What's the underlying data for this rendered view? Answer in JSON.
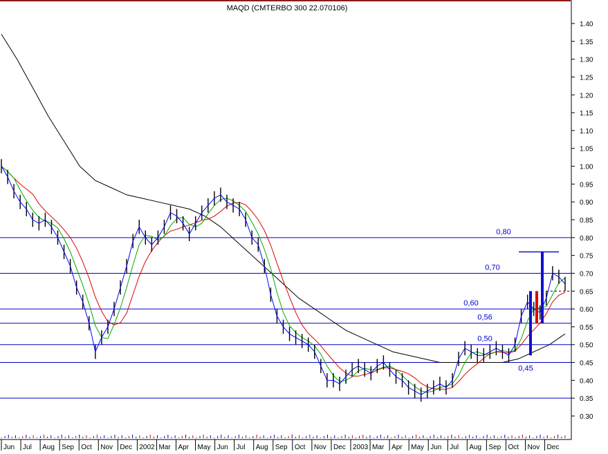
{
  "title_overlay": "MAQD (CMTERBO 300 22.070106)",
  "colors": {
    "hline": "#0000cc",
    "price_bar": "#000000",
    "ma_long": "#000000",
    "ma_mid": "#dd0000",
    "ma_short": "#00aa00",
    "ma_fast": "#0000ff",
    "highlight_up": "#1010cc",
    "highlight_down": "#dd0000",
    "top_border": "#8b1a1a"
  },
  "chart_data": {
    "type": "line",
    "title": "MAQD (CMTERBO 300 22.070106)",
    "ylim": [
      0.26,
      1.48
    ],
    "y_ticks": [
      "1.40",
      "1.35",
      "1.30",
      "1.25",
      "1.20",
      "1.15",
      "1.10",
      "1.05",
      "1.00",
      "0.95",
      "0.90",
      "0.85",
      "0.80",
      "0.75",
      "0.70",
      "0.65",
      "0.60",
      "0.55",
      "0.50",
      "0.45",
      "0.40",
      "0.35",
      "0.30"
    ],
    "x_labels": [
      "Jun",
      "Jul",
      "Aug",
      "Sep",
      "Oct",
      "Nov",
      "Dec",
      "2002",
      "Mar",
      "Apr",
      "May",
      "Jun",
      "Jul",
      "Aug",
      "Sep",
      "Oct",
      "Nov",
      "Dec",
      "2003",
      "Mar",
      "Apr",
      "May",
      "Jun",
      "Jul",
      "Aug",
      "Sep",
      "Oct",
      "Nov",
      "Dec"
    ],
    "horizontal_levels": [
      {
        "value": 0.8,
        "label": "0,80"
      },
      {
        "value": 0.7,
        "label": "0,70"
      },
      {
        "value": 0.6,
        "label": "0,60"
      },
      {
        "value": 0.56,
        "label": "0,56"
      },
      {
        "value": 0.5,
        "label": "0,50"
      },
      {
        "value": 0.45,
        "label": "0,45"
      },
      {
        "value": 0.35,
        "label": ""
      }
    ],
    "price_series": {
      "name": "",
      "x_start": 0,
      "values": [
        1.0,
        0.97,
        0.93,
        0.9,
        0.88,
        0.85,
        0.84,
        0.85,
        0.83,
        0.8,
        0.76,
        0.72,
        0.66,
        0.62,
        0.56,
        0.48,
        0.52,
        0.55,
        0.6,
        0.66,
        0.72,
        0.79,
        0.83,
        0.8,
        0.78,
        0.8,
        0.83,
        0.87,
        0.86,
        0.84,
        0.81,
        0.84,
        0.87,
        0.89,
        0.91,
        0.92,
        0.9,
        0.89,
        0.88,
        0.85,
        0.8,
        0.78,
        0.72,
        0.64,
        0.58,
        0.55,
        0.53,
        0.52,
        0.51,
        0.5,
        0.48,
        0.44,
        0.4,
        0.4,
        0.39,
        0.41,
        0.43,
        0.44,
        0.43,
        0.42,
        0.44,
        0.45,
        0.43,
        0.41,
        0.4,
        0.38,
        0.37,
        0.36,
        0.37,
        0.38,
        0.39,
        0.38,
        0.4,
        0.46,
        0.49,
        0.48,
        0.47,
        0.47,
        0.48,
        0.49,
        0.48,
        0.47,
        0.5,
        0.58,
        0.62,
        0.6,
        0.59,
        0.63,
        0.7,
        0.69,
        0.67
      ]
    },
    "ma_long": [
      1.37,
      1.3,
      1.22,
      1.14,
      1.07,
      1.0,
      0.96,
      0.94,
      0.92,
      0.91,
      0.9,
      0.89,
      0.88,
      0.86,
      0.83,
      0.79,
      0.75,
      0.71,
      0.67,
      0.63,
      0.6,
      0.57,
      0.54,
      0.52,
      0.5,
      0.48,
      0.47,
      0.46,
      0.45,
      0.45,
      0.45,
      0.45,
      0.45,
      0.46,
      0.48,
      0.5,
      0.53
    ],
    "ma_long_x": [
      0,
      8,
      16,
      24,
      32,
      40,
      48,
      56,
      64,
      72,
      80,
      88,
      96,
      104,
      112,
      120,
      128,
      136,
      144,
      152,
      160,
      168,
      176,
      184,
      192,
      200,
      208,
      216,
      224,
      232,
      240,
      248,
      256,
      264,
      272,
      280,
      288
    ],
    "highlights": [
      {
        "color": "up",
        "from": 0.47,
        "to": 0.65
      },
      {
        "color": "down",
        "from": 0.56,
        "to": 0.65
      },
      {
        "color": "up",
        "from": 0.56,
        "to": 0.76
      }
    ]
  }
}
